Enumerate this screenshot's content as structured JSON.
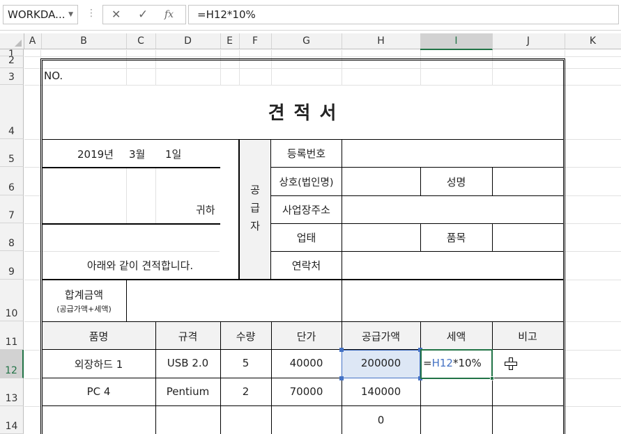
{
  "formula_bar": {
    "name_box": "WORKDA...",
    "cancel_icon": "✕",
    "enter_icon": "✓",
    "fx_icon": "fx",
    "formula": "=H12*10%"
  },
  "columns": [
    "A",
    "B",
    "C",
    "D",
    "E",
    "F",
    "G",
    "H",
    "I",
    "J",
    "K"
  ],
  "rows": [
    "1",
    "2",
    "3",
    "4",
    "5",
    "6",
    "7",
    "8",
    "9",
    "10",
    "11",
    "12",
    "13",
    "14"
  ],
  "sheet": {
    "no_label": "NO.",
    "title": "견 적 서",
    "date": {
      "year": "2019년",
      "month": "3월",
      "day": "1일"
    },
    "recipient_suffix": "귀하",
    "statement": "아래와 같이 견적합니다.",
    "total_label": "합계금액",
    "total_sub": "(공급가액+세액)",
    "supplier": {
      "vertical_label": [
        "공",
        "급",
        "자"
      ],
      "reg_no": "등록번호",
      "company": "상호(법인명)",
      "name": "성명",
      "address": "사업장주소",
      "biz_type": "업태",
      "item": "품목",
      "contact": "연락처"
    },
    "table_headers": [
      "품명",
      "규격",
      "수량",
      "단가",
      "공급가액",
      "세액",
      "비고"
    ],
    "items": [
      {
        "name": "외장하드 1",
        "spec": "USB 2.0",
        "qty": "5",
        "price": "40000",
        "supply": "200000"
      },
      {
        "name": "PC 4",
        "spec": "Pentium",
        "qty": "2",
        "price": "70000",
        "supply": "140000"
      },
      {
        "name": "",
        "spec": "",
        "qty": "",
        "price": "",
        "supply": "0"
      }
    ],
    "editing": {
      "prefix": "=",
      "ref": "H12",
      "suffix": "*10%"
    }
  },
  "colors": {
    "selected_header": "#217346",
    "ref_highlight": "#4472c4",
    "header_fill": "#f2f2f2"
  }
}
